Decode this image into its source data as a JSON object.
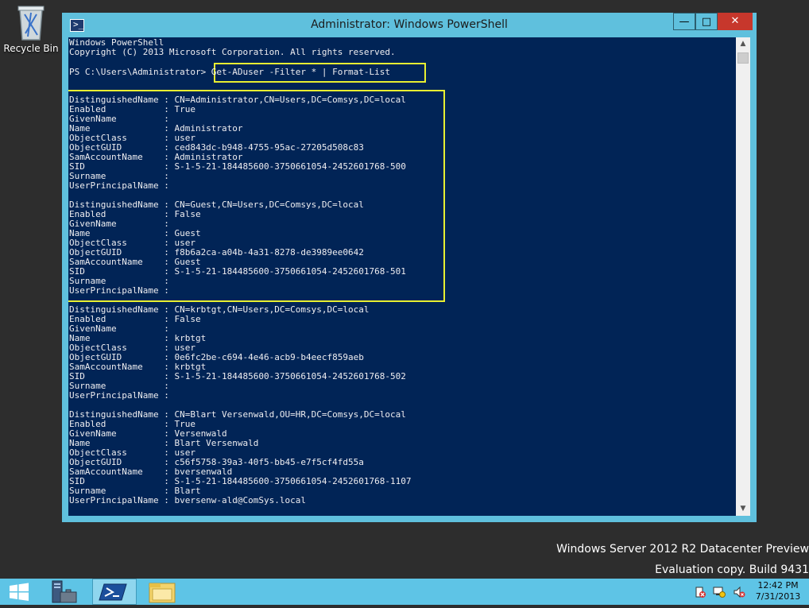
{
  "desktop": {
    "recycle_bin_label": "Recycle Bin",
    "watermark_line1": "Windows Server 2012 R2 Datacenter Preview",
    "watermark_line2": "Evaluation copy. Build 9431"
  },
  "window": {
    "title": "Administrator: Windows PowerShell",
    "minimize_glyph": "—",
    "maximize_glyph": "□",
    "close_glyph": "✕"
  },
  "console": {
    "lines": [
      "Windows PowerShell",
      "Copyright (C) 2013 Microsoft Corporation. All rights reserved.",
      "",
      "PS C:\\Users\\Administrator> Get-ADuser -Filter * | Format-List",
      "",
      "",
      "DistinguishedName : CN=Administrator,CN=Users,DC=Comsys,DC=local",
      "Enabled           : True",
      "GivenName         :",
      "Name              : Administrator",
      "ObjectClass       : user",
      "ObjectGUID        : ced843dc-b948-4755-95ac-27205d508c83",
      "SamAccountName    : Administrator",
      "SID               : S-1-5-21-184485600-3750661054-2452601768-500",
      "Surname           :",
      "UserPrincipalName :",
      "",
      "DistinguishedName : CN=Guest,CN=Users,DC=Comsys,DC=local",
      "Enabled           : False",
      "GivenName         :",
      "Name              : Guest",
      "ObjectClass       : user",
      "ObjectGUID        : f8b6a2ca-a04b-4a31-8278-de3989ee0642",
      "SamAccountName    : Guest",
      "SID               : S-1-5-21-184485600-3750661054-2452601768-501",
      "Surname           :",
      "UserPrincipalName :",
      "",
      "DistinguishedName : CN=krbtgt,CN=Users,DC=Comsys,DC=local",
      "Enabled           : False",
      "GivenName         :",
      "Name              : krbtgt",
      "ObjectClass       : user",
      "ObjectGUID        : 0e6fc2be-c694-4e46-acb9-b4eecf859aeb",
      "SamAccountName    : krbtgt",
      "SID               : S-1-5-21-184485600-3750661054-2452601768-502",
      "Surname           :",
      "UserPrincipalName :",
      "",
      "DistinguishedName : CN=Blart Versenwald,OU=HR,DC=Comsys,DC=local",
      "Enabled           : True",
      "GivenName         : Versenwald",
      "Name              : Blart Versenwald",
      "ObjectClass       : user",
      "ObjectGUID        : c56f5758-39a3-40f5-bb45-e7f5cf4fd55a",
      "SamAccountName    : bversenwald",
      "SID               : S-1-5-21-184485600-3750661054-2452601768-1107",
      "Surname           : Blart",
      "UserPrincipalName : bversenw-ald@ComSys.local"
    ]
  },
  "taskbar": {
    "time": "12:42 PM",
    "date": "7/31/2013",
    "items": [
      {
        "icon": "server-manager-icon"
      },
      {
        "icon": "powershell-icon"
      },
      {
        "icon": "file-explorer-icon"
      }
    ],
    "tray": [
      "action-center-icon",
      "network-icon",
      "volume-icon"
    ]
  },
  "colors": {
    "console_bg": "#012456",
    "console_fg": "#eeedf0",
    "window_frame": "#5fc0dd",
    "highlight": "#e8ef31",
    "taskbar": "#5ec4e6",
    "close_button": "#c7372c"
  }
}
